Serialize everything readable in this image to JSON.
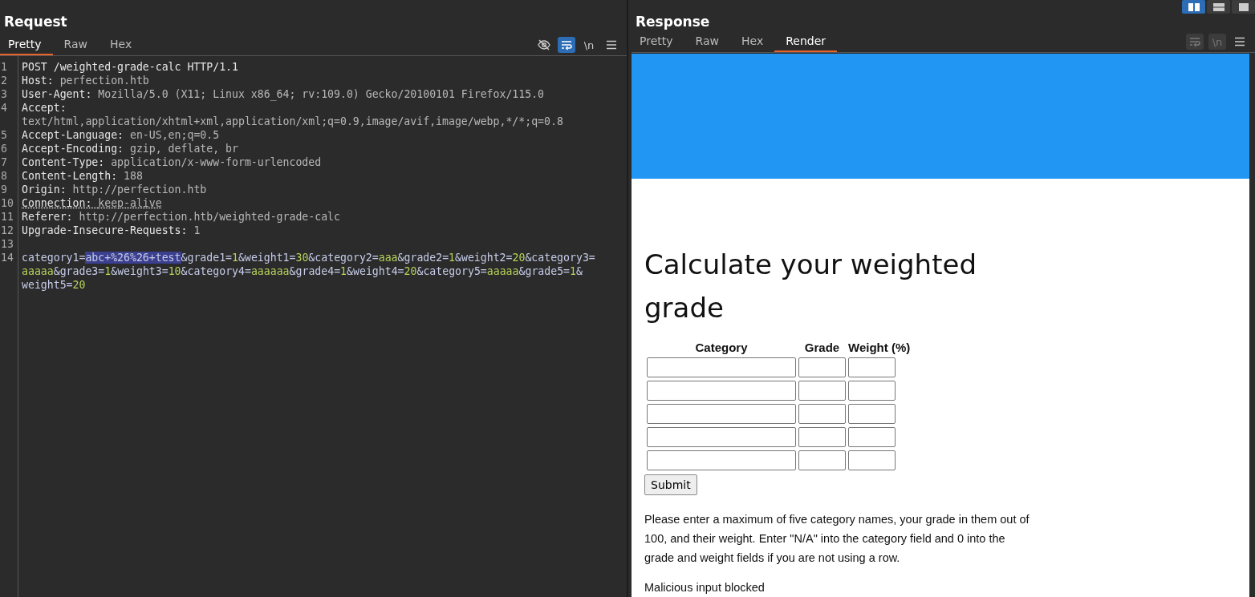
{
  "view_toggles": [
    {
      "selected": true
    },
    {
      "selected": false
    },
    {
      "selected": false
    }
  ],
  "request": {
    "title": "Request",
    "tabs": [
      {
        "label": "Pretty",
        "selected": true
      },
      {
        "label": "Raw",
        "selected": false
      },
      {
        "label": "Hex",
        "selected": false
      }
    ],
    "toolbar": [
      {
        "kind": "hide",
        "active": false
      },
      {
        "kind": "wrap",
        "active": true
      },
      {
        "kind": "newline",
        "label": "\\n",
        "active": false
      },
      {
        "kind": "menu",
        "active": false
      }
    ],
    "lines": [
      {
        "number": "1",
        "flagged": false,
        "rows": [
          [
            {
              "kind": "plain",
              "text": "POST /weighted-grade-calc HTTP/1.1"
            }
          ]
        ]
      },
      {
        "number": "2",
        "flagged": false,
        "rows": [
          [
            {
              "kind": "key",
              "text": "Host: "
            },
            {
              "kind": "value",
              "text": "perfection.htb"
            }
          ]
        ]
      },
      {
        "number": "3",
        "flagged": false,
        "rows": [
          [
            {
              "kind": "key",
              "text": "User-Agent: "
            },
            {
              "kind": "value",
              "text": "Mozilla/5.0 (X11; Linux x86_64; rv:109.0) Gecko/20100101 Firefox/115.0"
            }
          ]
        ]
      },
      {
        "number": "4",
        "flagged": false,
        "rows": [
          [
            {
              "kind": "key",
              "text": "Accept: "
            },
            {
              "kind": "value",
              "text": "text/html,application/xhtml+xml,application/xml;q=0.9,image/avif,image/webp,*/*;q=0.8"
            }
          ]
        ]
      },
      {
        "number": "5",
        "flagged": false,
        "rows": [
          [
            {
              "kind": "key",
              "text": "Accept-Language: "
            },
            {
              "kind": "value",
              "text": "en-US,en;q=0.5"
            }
          ]
        ]
      },
      {
        "number": "6",
        "flagged": false,
        "rows": [
          [
            {
              "kind": "key",
              "text": "Accept-Encoding: "
            },
            {
              "kind": "value",
              "text": "gzip, deflate, br"
            }
          ]
        ]
      },
      {
        "number": "7",
        "flagged": false,
        "rows": [
          [
            {
              "kind": "key",
              "text": "Content-Type: "
            },
            {
              "kind": "value",
              "text": "application/x-www-form-urlencoded"
            }
          ]
        ]
      },
      {
        "number": "8",
        "flagged": false,
        "rows": [
          [
            {
              "kind": "key",
              "text": "Content-Length: "
            },
            {
              "kind": "value",
              "text": "188"
            }
          ]
        ]
      },
      {
        "number": "9",
        "flagged": false,
        "rows": [
          [
            {
              "kind": "key",
              "text": "Origin: "
            },
            {
              "kind": "value",
              "text": "http://perfection.htb"
            }
          ]
        ]
      },
      {
        "number": "10",
        "flagged": true,
        "rows": [
          [
            {
              "kind": "key",
              "text": "Connection: "
            },
            {
              "kind": "value",
              "text": "keep-alive"
            }
          ]
        ]
      },
      {
        "number": "11",
        "flagged": false,
        "rows": [
          [
            {
              "kind": "key",
              "text": "Referer: "
            },
            {
              "kind": "value",
              "text": "http://perfection.htb/weighted-grade-calc"
            }
          ]
        ]
      },
      {
        "number": "12",
        "flagged": false,
        "rows": [
          [
            {
              "kind": "key",
              "text": "Upgrade-Insecure-Requests: "
            },
            {
              "kind": "value",
              "text": "1"
            }
          ]
        ]
      },
      {
        "number": "13",
        "rows": [
          []
        ]
      },
      {
        "number": "14",
        "flagged": false,
        "rows": [
          [
            {
              "kind": "param",
              "text": "category1="
            },
            {
              "kind": "selected",
              "text": "abc+%26%26+test"
            },
            {
              "kind": "param",
              "text": "&grade1="
            },
            {
              "kind": "num",
              "text": "1"
            },
            {
              "kind": "param",
              "text": "&weight1="
            },
            {
              "kind": "num",
              "text": "30"
            },
            {
              "kind": "param",
              "text": "&category2="
            },
            {
              "kind": "num",
              "text": "aaa"
            },
            {
              "kind": "param",
              "text": "&grade2="
            },
            {
              "kind": "num",
              "text": "1"
            },
            {
              "kind": "param",
              "text": "&weight2="
            },
            {
              "kind": "num",
              "text": "20"
            },
            {
              "kind": "param",
              "text": "&category3="
            },
            {
              "kind": "num",
              "text": "aaaaa"
            },
            {
              "kind": "param",
              "text": "&grade3="
            },
            {
              "kind": "num",
              "text": "1"
            },
            {
              "kind": "param",
              "text": "&weight3="
            },
            {
              "kind": "num",
              "text": "10"
            },
            {
              "kind": "param",
              "text": "&category4="
            },
            {
              "kind": "num",
              "text": "aaaaaa"
            },
            {
              "kind": "param",
              "text": "&grade4="
            },
            {
              "kind": "num",
              "text": "1"
            },
            {
              "kind": "param",
              "text": "&weight4="
            },
            {
              "kind": "num",
              "text": "20"
            },
            {
              "kind": "param",
              "text": "&category5="
            },
            {
              "kind": "num",
              "text": "aaaaa"
            },
            {
              "kind": "param",
              "text": "&grade5="
            },
            {
              "kind": "num",
              "text": "1"
            },
            {
              "kind": "param",
              "text": "&"
            },
            {
              "kind": "param",
              "text": "weight5="
            },
            {
              "kind": "num",
              "text": "20"
            }
          ]
        ]
      }
    ]
  },
  "response": {
    "title": "Response",
    "tabs": [
      {
        "label": "Pretty",
        "selected": false
      },
      {
        "label": "Raw",
        "selected": false
      },
      {
        "label": "Hex",
        "selected": false
      },
      {
        "label": "Render",
        "selected": true
      }
    ],
    "toolbar": [
      {
        "kind": "wrap",
        "active": false
      },
      {
        "kind": "newline",
        "label": "\\n",
        "active": false
      },
      {
        "kind": "menu",
        "active": false
      }
    ],
    "render": {
      "heading": "Calculate your weighted grade",
      "columns": [
        "Category",
        "Grade",
        "Weight (%)"
      ],
      "submit": "Submit",
      "instructions": "Please enter a maximum of five category names, your grade in them out of 100, and their weight. Enter \"N/A\" into the category field and 0 into the grade and weight fields if you are not using a row.",
      "message": "Malicious input blocked"
    }
  }
}
